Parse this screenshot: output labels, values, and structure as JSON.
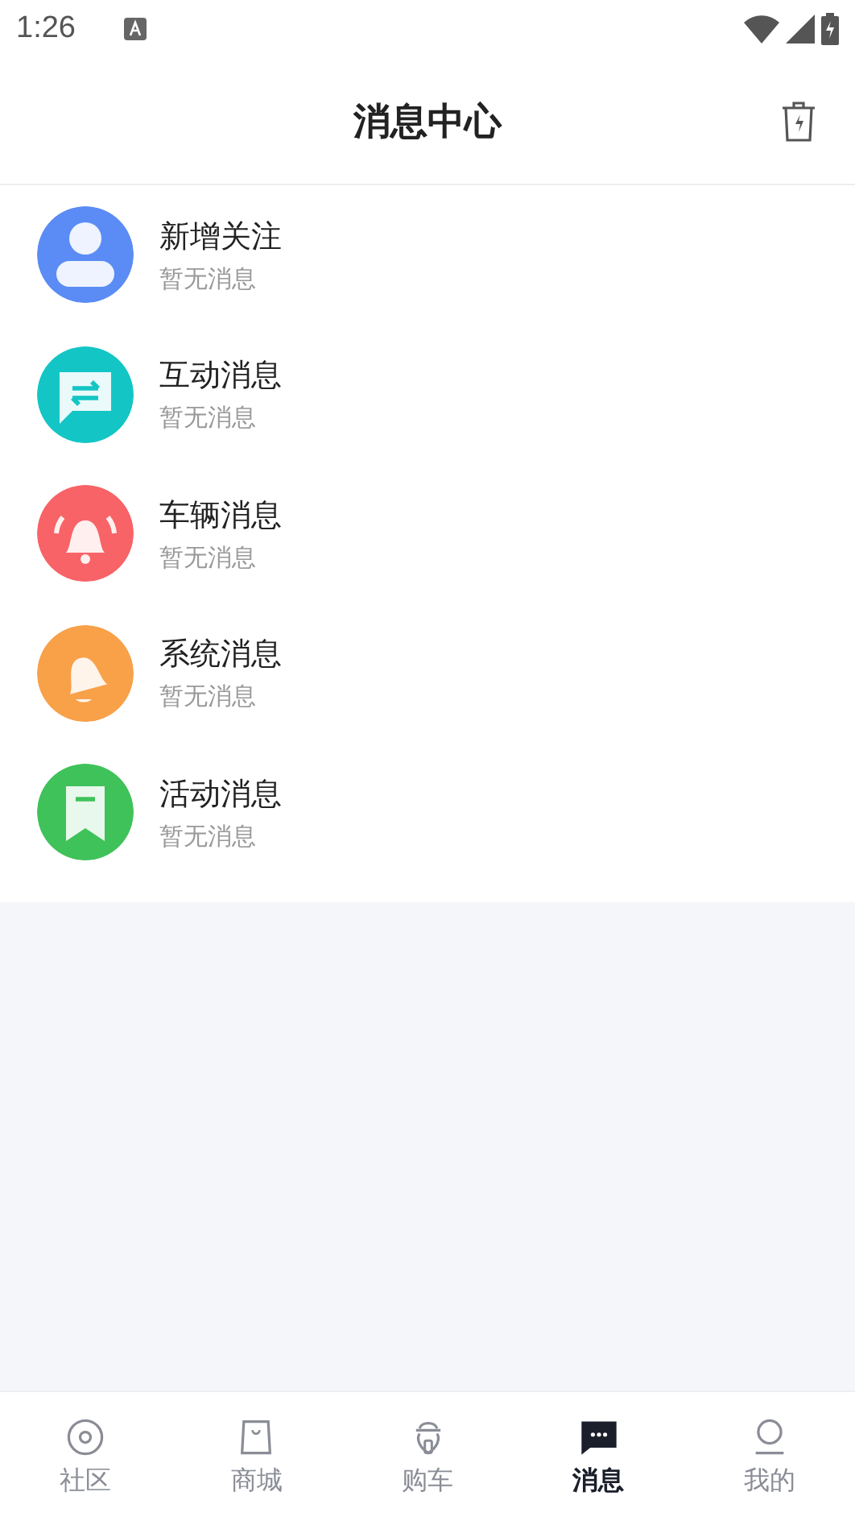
{
  "status_bar": {
    "time": "1:26"
  },
  "header": {
    "title": "消息中心"
  },
  "messages": [
    {
      "kind": "person",
      "color": "#5b8cf5",
      "title": "新增关注",
      "subtitle": "暂无消息"
    },
    {
      "kind": "chat",
      "color": "#13c6c5",
      "title": "互动消息",
      "subtitle": "暂无消息"
    },
    {
      "kind": "alarm",
      "color": "#f86368",
      "title": "车辆消息",
      "subtitle": "暂无消息"
    },
    {
      "kind": "bell",
      "color": "#f8a149",
      "title": "系统消息",
      "subtitle": "暂无消息"
    },
    {
      "kind": "bookmark",
      "color": "#3fc25a",
      "title": "活动消息",
      "subtitle": "暂无消息"
    }
  ],
  "tabs": [
    {
      "kind": "community",
      "label": "社区",
      "selected": false
    },
    {
      "kind": "shop",
      "label": "商城",
      "selected": false
    },
    {
      "kind": "scooter",
      "label": "购车",
      "selected": false
    },
    {
      "kind": "messages",
      "label": "消息",
      "selected": true
    },
    {
      "kind": "profile",
      "label": "我的",
      "selected": false
    }
  ]
}
